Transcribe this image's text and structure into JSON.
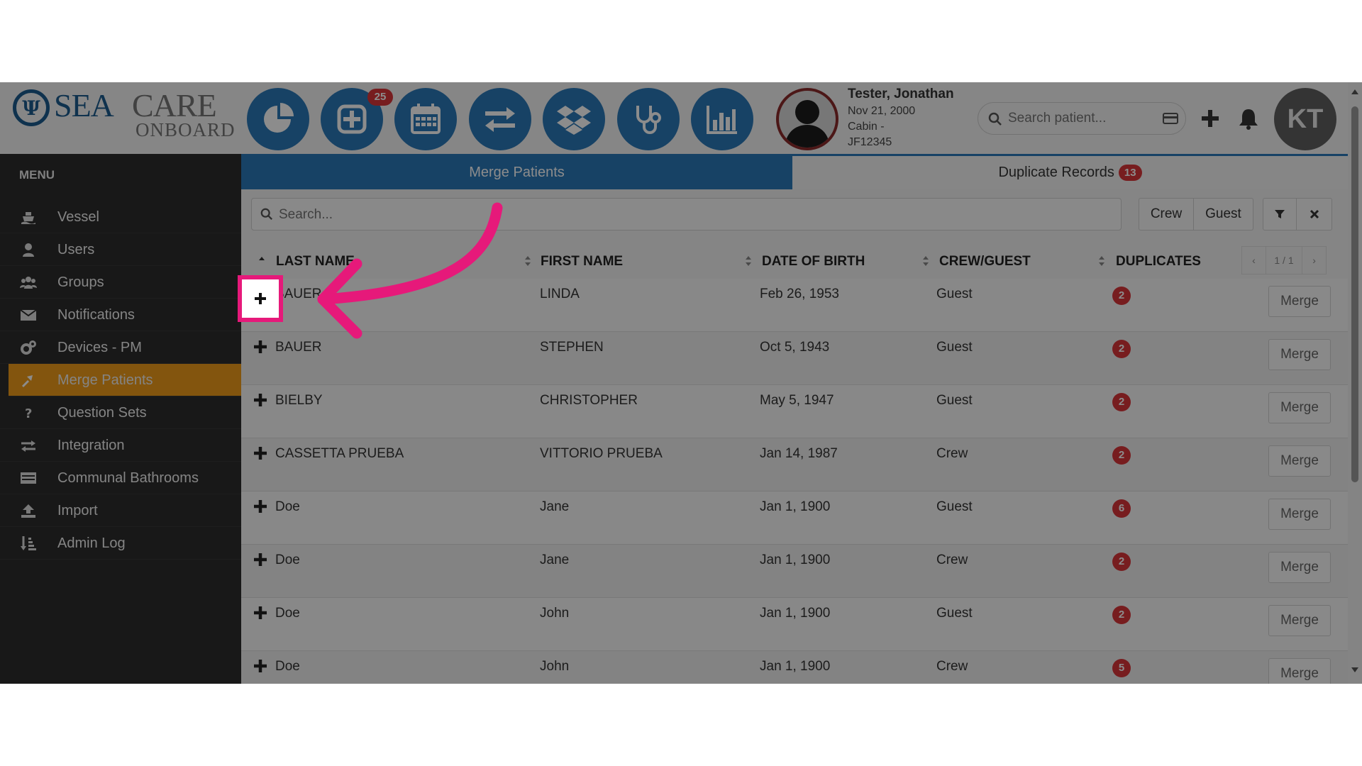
{
  "logo": {
    "sea": "SEA",
    "care": "CARE",
    "onboard": "ONBOARD",
    "mark": "Ψ"
  },
  "nav_icons": [
    "dashboard-pie-icon",
    "medical-plus-icon",
    "calendar-icon",
    "exchange-arrows-icon",
    "dropbox-icon",
    "stethoscope-icon",
    "bar-chart-icon"
  ],
  "nav_badge": "25",
  "patient": {
    "name": "Tester, Jonathan",
    "dob": "Nov 21, 2000",
    "cabin": "Cabin -",
    "id": "JF12345"
  },
  "search_patient": {
    "placeholder": "Search patient..."
  },
  "user_initials": "KT",
  "menu": {
    "title": "MENU",
    "items": [
      {
        "label": "Vessel",
        "icon": "ship-icon"
      },
      {
        "label": "Users",
        "icon": "user-icon"
      },
      {
        "label": "Groups",
        "icon": "group-icon"
      },
      {
        "label": "Notifications",
        "icon": "envelope-icon"
      },
      {
        "label": "Devices - PM",
        "icon": "gears-icon"
      },
      {
        "label": "Merge Patients",
        "icon": "merge-icon",
        "active": true
      },
      {
        "label": "Question Sets",
        "icon": "question-icon"
      },
      {
        "label": "Integration",
        "icon": "exchange-icon"
      },
      {
        "label": "Communal Bathrooms",
        "icon": "list-icon"
      },
      {
        "label": "Import",
        "icon": "upload-icon"
      },
      {
        "label": "Admin Log",
        "icon": "sort-list-icon"
      }
    ]
  },
  "tabs": {
    "merge": "Merge Patients",
    "duplicates": "Duplicate Records",
    "duplicates_count": "13"
  },
  "table_search": {
    "placeholder": "Search..."
  },
  "filters": {
    "crew": "Crew",
    "guest": "Guest"
  },
  "columns": {
    "last_name": "LAST NAME",
    "first_name": "FIRST NAME",
    "dob": "DATE OF BIRTH",
    "crew_guest": "CREW/GUEST",
    "duplicates": "DUPLICATES"
  },
  "pager": {
    "prev": "‹",
    "page": "1 / 1",
    "next": "›"
  },
  "rows": [
    {
      "last": "BAUER",
      "first": "LINDA",
      "dob": "Feb 26, 1953",
      "type": "Guest",
      "dups": "2",
      "action": "Merge"
    },
    {
      "last": "BAUER",
      "first": "STEPHEN",
      "dob": "Oct 5, 1943",
      "type": "Guest",
      "dups": "2",
      "action": "Merge"
    },
    {
      "last": "BIELBY",
      "first": "CHRISTOPHER",
      "dob": "May 5, 1947",
      "type": "Guest",
      "dups": "2",
      "action": "Merge"
    },
    {
      "last": "CASSETTA PRUEBA",
      "first": "VITTORIO PRUEBA",
      "dob": "Jan 14, 1987",
      "type": "Crew",
      "dups": "2",
      "action": "Merge"
    },
    {
      "last": "Doe",
      "first": "Jane",
      "dob": "Jan 1, 1900",
      "type": "Guest",
      "dups": "6",
      "action": "Merge"
    },
    {
      "last": "Doe",
      "first": "Jane",
      "dob": "Jan 1, 1900",
      "type": "Crew",
      "dups": "2",
      "action": "Merge"
    },
    {
      "last": "Doe",
      "first": "John",
      "dob": "Jan 1, 1900",
      "type": "Guest",
      "dups": "2",
      "action": "Merge"
    },
    {
      "last": "Doe",
      "first": "John",
      "dob": "Jan 1, 1900",
      "type": "Crew",
      "dups": "5",
      "action": "Merge"
    }
  ],
  "colors": {
    "primary": "#2b78b8",
    "active_menu": "#ef9c1a",
    "badge": "#d9363a",
    "highlight": "#e6197a"
  }
}
